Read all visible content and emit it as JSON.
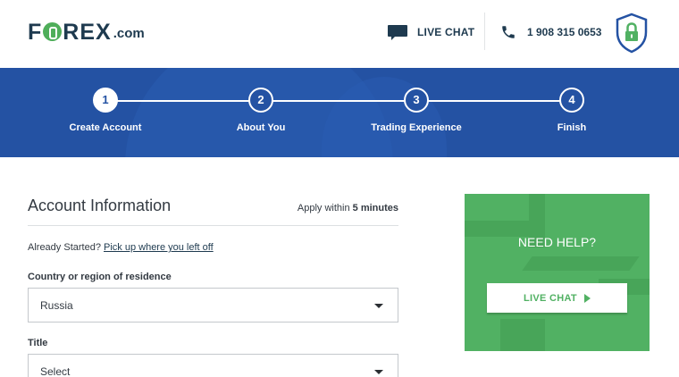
{
  "header": {
    "logo": {
      "prefix": "F",
      "suffix": "REX",
      "domain": ".com"
    },
    "live_chat_label": "LIVE CHAT",
    "phone_number": "1 908 315 0653",
    "icons": [
      "chat-icon",
      "phone-icon",
      "lock-shield-icon"
    ]
  },
  "progress": {
    "steps": [
      {
        "number": "1",
        "label": "Create Account",
        "active": true
      },
      {
        "number": "2",
        "label": "About You",
        "active": false
      },
      {
        "number": "3",
        "label": "Trading Experience",
        "active": false
      },
      {
        "number": "4",
        "label": "Finish",
        "active": false
      }
    ]
  },
  "form": {
    "title": "Account Information",
    "apply_prefix": "Apply within ",
    "apply_time": "5 minutes",
    "already_text": "Already Started? ",
    "resume_link": "Pick up where you left off",
    "country": {
      "label": "Country or region of residence",
      "value": "Russia"
    },
    "title_field": {
      "label": "Title",
      "value": "Select"
    }
  },
  "help": {
    "title": "NEED HELP?",
    "button_label": "LIVE CHAT"
  },
  "colors": {
    "navy": "#1e3a4f",
    "brand_blue": "#2452a3",
    "brand_green": "#51b163"
  }
}
